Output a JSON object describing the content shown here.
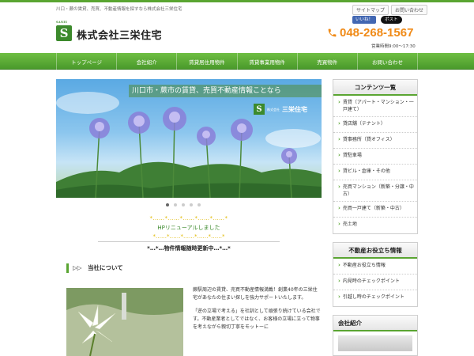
{
  "header": {
    "tagline": "川口・蕨の賃貸、売買、不動産情報を探すなら株式会社三栄住宅",
    "util_links": [
      "サイトマップ",
      "お問い合わせ"
    ],
    "fb_like": "いいね！",
    "x_post": "ポスト",
    "logo_letter": "S",
    "logo_sub": "SANEI",
    "logo_text": "株式会社三栄住宅",
    "phone": "048-268-1567",
    "hours": "営業時間9:00～17:30"
  },
  "nav": {
    "items": [
      "トップページ",
      "会社紹介",
      "賃貸居住用物件",
      "賃貸事業用物件",
      "売買物件",
      "お問い合わせ"
    ]
  },
  "slider": {
    "caption": "川口市・蕨市の賃貸、売買不動産情報ことなら",
    "logo_letter": "S",
    "logo_sub": "株式会社",
    "logo_text": "三栄住宅",
    "dots": 5,
    "active_dot": 0
  },
  "news": {
    "deco1": "*……*……*……*……*……*",
    "renewal": "HPリニューアルしました",
    "deco2": "*……*……*……*……*……*",
    "update": "*…*…物件情報随時更新中…*…*"
  },
  "about": {
    "heading": "▷▷　当社について",
    "paragraphs": [
      "蕨駅周辺の賃貸、売買不動産情報満載！創業40年の三栄住宅があなたの住まい探しを強力サポートいたします。",
      "「逆の立場で考える」を社訓として頑張り続けている会社です。不動産業者としてではなく、お客様の立場に立って物事を考えながら親切丁寧をモットーに"
    ]
  },
  "sidebar": {
    "contents_title": "コンテンツ一覧",
    "contents_items": [
      "賃貸（アパート・マンション・一戸建て）",
      "貸店舗（テナント）",
      "貸事務所（貸オフィス）",
      "貸駐車場",
      "貸ビル・倉庫・その他",
      "売買マンション（新築・分譲・中古）",
      "売買一戸建て（新築・中古）",
      "売土地"
    ],
    "info_title": "不動産お役立ち情報",
    "info_items": [
      "不動産お役立ち情報",
      "内見時のチェックポイント",
      "引越し時のチェックポイント"
    ],
    "company_title": "会社紹介"
  },
  "colors": {
    "brand_green": "#5aa532",
    "phone_orange": "#f08a16"
  }
}
